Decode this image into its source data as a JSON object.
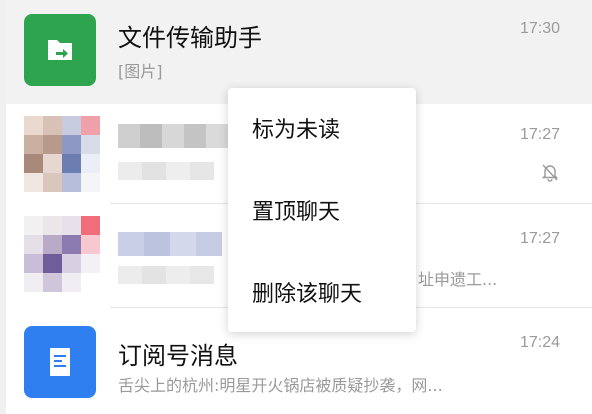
{
  "chats": [
    {
      "title": "文件传输助手",
      "subtitle": "[图片]",
      "time": "17:30",
      "icon": "folder-transfer-icon",
      "avatar_color": "#2ea44f",
      "pinned": true
    },
    {
      "title": "",
      "subtitle": "",
      "time": "17:27",
      "mute_icon": "bell-off-icon",
      "blurred": true
    },
    {
      "title": "",
      "subtitle": "址申遗工...",
      "time": "17:27",
      "blurred": true
    },
    {
      "title": "订阅号消息",
      "subtitle": "舌尖上的杭州:明星开火锅店被质疑抄袭，网...",
      "time": "17:24",
      "icon": "document-icon",
      "avatar_color": "#2f7ff0"
    }
  ],
  "context_menu": {
    "items": [
      "标为未读",
      "置顶聊天",
      "删除该聊天"
    ]
  }
}
